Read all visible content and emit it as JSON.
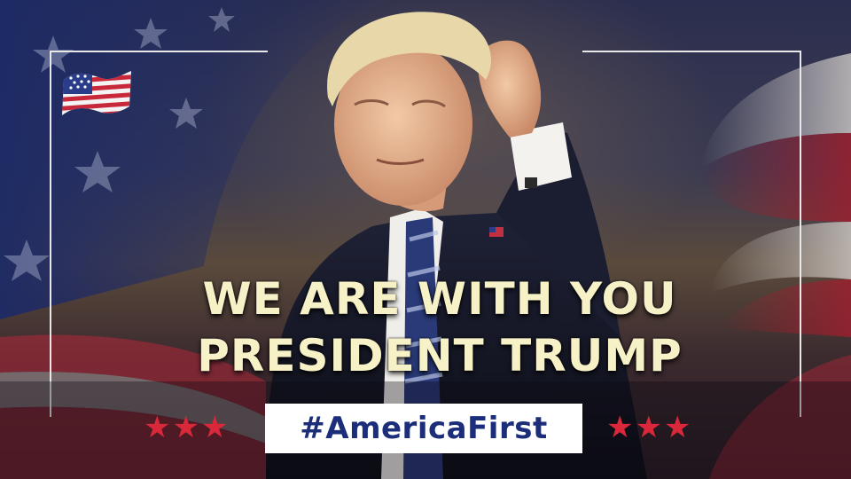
{
  "headline": {
    "line1": "WE ARE WITH YOU",
    "line2": "PRESIDENT TRUMP"
  },
  "hashtag": "#AmericaFirst",
  "decorations": {
    "left_stars": "★★★",
    "right_stars": "★★★",
    "star_color": "#d8283a",
    "flag_icon": "american-flag-icon"
  },
  "colors": {
    "headline_text": "#f7f1c8",
    "hashtag_text": "#1c2d7a",
    "hashtag_bg": "#ffffff"
  }
}
